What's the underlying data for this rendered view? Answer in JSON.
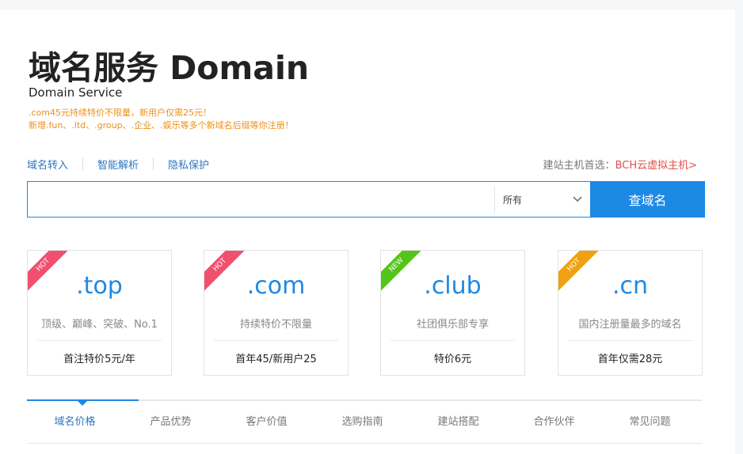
{
  "header": {
    "title": "域名服务 Domain",
    "subtitle": "Domain Service",
    "promo_line1": ".com45元持续特价不限量，新用户仅需25元！",
    "promo_line2": "新增.fun、.ltd、.group、.企业、.娱乐等多个新域名后缀等你注册！"
  },
  "quick_links": [
    "域名转入",
    "智能解析",
    "隐私保护"
  ],
  "host_promo": {
    "prefix": "建站主机首选：",
    "link": "BCH云虚拟主机>"
  },
  "search": {
    "input_value": "",
    "placeholder": "",
    "select_value": "所有",
    "button_label": "查域名"
  },
  "cards": [
    {
      "ribbon": "HOT",
      "ribbon_color": "#f0506e",
      "ext": ".top",
      "desc": "顶级、巅峰、突破、No.1",
      "price": "首注特价5元/年"
    },
    {
      "ribbon": "HOT",
      "ribbon_color": "#f0506e",
      "ext": ".com",
      "desc": "持续特价不限量",
      "price": "首年45/新用户25"
    },
    {
      "ribbon": "NEW",
      "ribbon_color": "#52c41a",
      "ext": ".club",
      "desc": "社团俱乐部专享",
      "price": "特价6元"
    },
    {
      "ribbon": "HOT",
      "ribbon_color": "#f0a010",
      "ext": ".cn",
      "desc": "国内注册量最多的域名",
      "price": "首年仅需28元"
    }
  ],
  "tabs": {
    "items": [
      "域名价格",
      "产品优势",
      "客户价值",
      "选购指南",
      "建站搭配",
      "合作伙伴",
      "常见问题"
    ],
    "active": "域名价格"
  },
  "colors": {
    "accent": "#1e88e5",
    "promo_orange": "#ef8f16",
    "link_blue": "#2d75c0",
    "promo_red": "#e0504e"
  },
  "icons": {
    "select_caret": "chevron-down-icon"
  }
}
